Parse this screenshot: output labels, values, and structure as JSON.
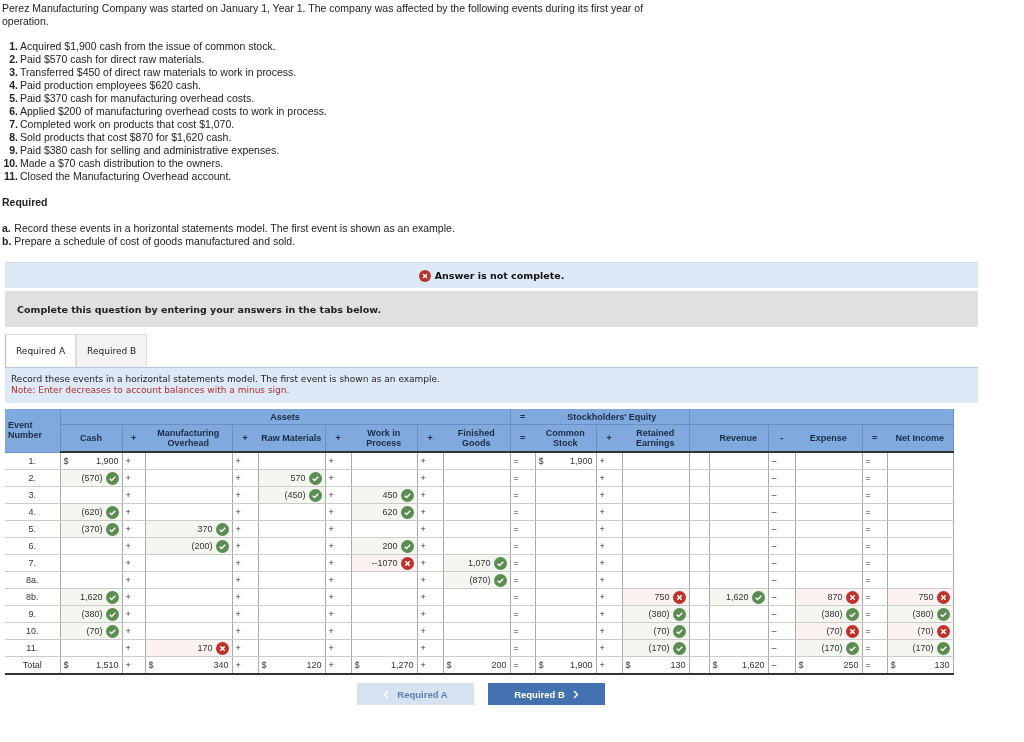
{
  "intro": "Perez Manufacturing Company was started on January 1, Year 1. The company was affected by the following events during its first year of operation.",
  "events": [
    {
      "number": "1.",
      "text": "Acquired $1,900 cash from the issue of common stock."
    },
    {
      "number": "2.",
      "text": "Paid $570 cash for direct raw materials."
    },
    {
      "number": "3.",
      "text": "Transferred $450 of direct raw materials to work in process."
    },
    {
      "number": "4.",
      "text": "Paid production employees $620 cash."
    },
    {
      "number": "5.",
      "text": "Paid $370 cash for manufacturing overhead costs."
    },
    {
      "number": "6.",
      "text": "Applied $200 of manufacturing overhead costs to work in process."
    },
    {
      "number": "7.",
      "text": "Completed work on products that cost $1,070."
    },
    {
      "number": "8.",
      "text": "Sold products that cost $870 for $1,620 cash."
    },
    {
      "number": "9.",
      "text": "Paid $380 cash for selling and administrative expenses."
    },
    {
      "number": "10.",
      "text": "Made a $70 cash distribution to the owners."
    },
    {
      "number": "11.",
      "text": "Closed the Manufacturing Overhead account."
    }
  ],
  "required_heading": "Required",
  "requirements": [
    {
      "letter": "a.",
      "text": "Record these events in a horizontal statements model. The first event is shown as an example."
    },
    {
      "letter": "b.",
      "text": "Prepare a schedule of cost of goods manufactured and sold."
    }
  ],
  "status_banner": "Answer is not complete.",
  "instruction_banner": "Complete this question by entering your answers in the tabs below.",
  "tabs": [
    {
      "label": "Required A",
      "selected": true
    },
    {
      "label": "Required B",
      "selected": false
    }
  ],
  "prompt": "Record these events in a horizontal statements model. The first event is shown as an example.",
  "note": "Note: Enter decreases to account balances with a minus sign.",
  "table": {
    "event_header": "Event Number",
    "groups": {
      "assets": "Assets",
      "equals": "=",
      "equity": "Stockholders' Equity"
    },
    "columns": [
      "Cash",
      "Manufacturing Overhead",
      "Raw Materials",
      "Work in Process",
      "Finished Goods",
      "Common Stock",
      "Retained Earnings",
      "Revenue",
      "Expense",
      "Net Income"
    ],
    "header_ops": [
      "+",
      "+",
      "+",
      "+",
      "=",
      "+",
      "-",
      "="
    ],
    "rows": [
      {
        "label": "1.",
        "ops": [
          "+",
          "+",
          "+",
          "+",
          "=",
          "+",
          "–",
          "="
        ],
        "cells": [
          {
            "currency": "$",
            "v": "1,900"
          },
          null,
          null,
          null,
          null,
          {
            "currency": "$",
            "v": "1,900"
          },
          null,
          null,
          null,
          null
        ]
      },
      {
        "label": "2.",
        "ops": [
          "+",
          "+",
          "+",
          "+",
          "=",
          "+",
          "–",
          "="
        ],
        "cells": [
          {
            "v": "(570)",
            "correct": true
          },
          null,
          {
            "v": "570",
            "correct": true
          },
          null,
          null,
          null,
          null,
          null,
          null,
          null
        ]
      },
      {
        "label": "3.",
        "ops": [
          "+",
          "+",
          "+",
          "+",
          "=",
          "+",
          "–",
          "="
        ],
        "cells": [
          null,
          null,
          {
            "v": "(450)",
            "correct": true
          },
          {
            "v": "450",
            "correct": true
          },
          null,
          null,
          null,
          null,
          null,
          null
        ]
      },
      {
        "label": "4.",
        "ops": [
          "+",
          "+",
          "+",
          "+",
          "=",
          "+",
          "–",
          "="
        ],
        "cells": [
          {
            "v": "(620)",
            "correct": true
          },
          null,
          null,
          {
            "v": "620",
            "correct": true
          },
          null,
          null,
          null,
          null,
          null,
          null
        ]
      },
      {
        "label": "5.",
        "ops": [
          "+",
          "+",
          "+",
          "+",
          "=",
          "+",
          "–",
          "="
        ],
        "cells": [
          {
            "v": "(370)",
            "correct": true
          },
          {
            "v": "370",
            "correct": true
          },
          null,
          null,
          null,
          null,
          null,
          null,
          null,
          null
        ]
      },
      {
        "label": "6.",
        "ops": [
          "+",
          "+",
          "+",
          "+",
          "=",
          "+",
          "–",
          "="
        ],
        "cells": [
          null,
          {
            "v": "(200)",
            "correct": true
          },
          null,
          {
            "v": "200",
            "correct": true
          },
          null,
          null,
          null,
          null,
          null,
          null
        ]
      },
      {
        "label": "7.",
        "ops": [
          "+",
          "+",
          "+",
          "+",
          "=",
          "+",
          "–",
          "="
        ],
        "cells": [
          null,
          null,
          null,
          {
            "v": "--1070",
            "correct": false
          },
          {
            "v": "1,070",
            "correct": true
          },
          null,
          null,
          null,
          null,
          null
        ]
      },
      {
        "label": "8a.",
        "ops": [
          "+",
          "+",
          "+",
          "+",
          "=",
          "+",
          "–",
          "="
        ],
        "cells": [
          null,
          null,
          null,
          null,
          {
            "v": "(870)",
            "correct": true
          },
          null,
          null,
          null,
          null,
          null
        ]
      },
      {
        "label": "8b.",
        "ops": [
          "+",
          "+",
          "+",
          "+",
          "=",
          "+",
          "–",
          "="
        ],
        "cells": [
          {
            "v": "1,620",
            "correct": true
          },
          null,
          null,
          null,
          null,
          null,
          {
            "v": "750",
            "correct": false
          },
          {
            "v": "1,620",
            "correct": true
          },
          {
            "v": "870",
            "correct": false
          },
          {
            "v": "750",
            "correct": false
          }
        ]
      },
      {
        "label": "9.",
        "ops": [
          "+",
          "+",
          "+",
          "+",
          "=",
          "+",
          "–",
          "="
        ],
        "cells": [
          {
            "v": "(380)",
            "correct": true
          },
          null,
          null,
          null,
          null,
          null,
          {
            "v": "(380)",
            "correct": true
          },
          null,
          {
            "v": "(380)",
            "correct": true
          },
          {
            "v": "(380)",
            "correct": true
          }
        ]
      },
      {
        "label": "10.",
        "ops": [
          "+",
          "+",
          "+",
          "+",
          "=",
          "+",
          "–",
          "="
        ],
        "cells": [
          {
            "v": "(70)",
            "correct": true
          },
          null,
          null,
          null,
          null,
          null,
          {
            "v": "(70)",
            "correct": true
          },
          null,
          {
            "v": "(70)",
            "correct": false
          },
          {
            "v": "(70)",
            "correct": false
          }
        ]
      },
      {
        "label": "11.",
        "ops": [
          "+",
          "+",
          "+",
          "+",
          "=",
          "+",
          "–",
          "="
        ],
        "cells": [
          null,
          {
            "v": "170",
            "correct": false
          },
          null,
          null,
          null,
          null,
          {
            "v": "(170)",
            "correct": true
          },
          null,
          {
            "v": "(170)",
            "correct": true
          },
          {
            "v": "(170)",
            "correct": true
          }
        ]
      },
      {
        "label": "Total",
        "ops": [
          "+",
          "+",
          "+",
          "+",
          "=",
          "+",
          "–",
          "="
        ],
        "cells": [
          {
            "currency": "$",
            "v": "1,510"
          },
          {
            "currency": "$",
            "v": "340"
          },
          {
            "currency": "$",
            "v": "120"
          },
          {
            "currency": "$",
            "v": "1,270"
          },
          {
            "currency": "$",
            "v": "200"
          },
          {
            "currency": "$",
            "v": "1,900"
          },
          {
            "currency": "$",
            "v": "130"
          },
          {
            "currency": "$",
            "v": "1,620"
          },
          {
            "currency": "$",
            "v": "250"
          },
          {
            "currency": "$",
            "v": "130"
          }
        ]
      }
    ]
  },
  "nav": [
    {
      "label": "Required A",
      "kind": "back",
      "disabled": true
    },
    {
      "label": "Required B",
      "kind": "forward",
      "disabled": false
    }
  ]
}
